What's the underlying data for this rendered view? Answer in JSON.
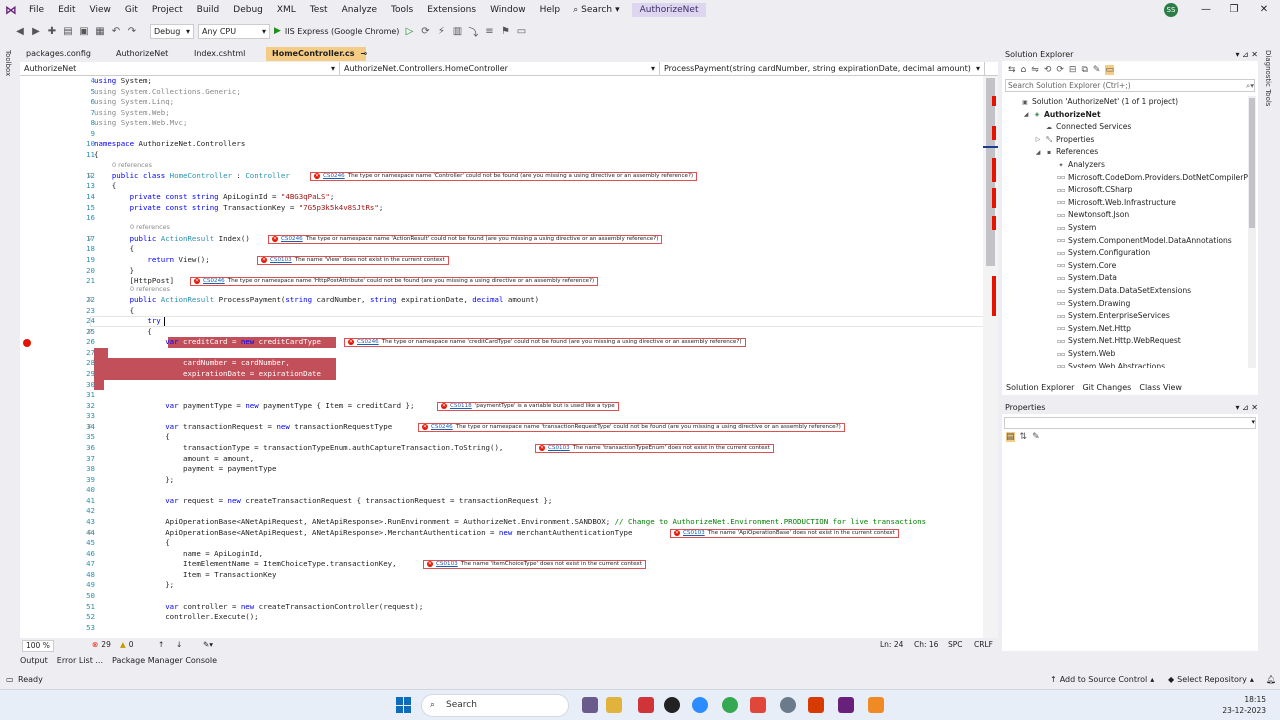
{
  "menubar": {
    "items": [
      "File",
      "Edit",
      "View",
      "Git",
      "Project",
      "Build",
      "Debug",
      "XML",
      "Test",
      "Analyze",
      "Tools",
      "Extensions",
      "Window",
      "Help"
    ],
    "search_label": "Search",
    "solution_title": "AuthorizeNet",
    "user_initials": "SS"
  },
  "toolbar": {
    "config": "Debug",
    "platform": "Any CPU",
    "run_label": "IIS Express (Google Chrome)"
  },
  "sidebars": {
    "left_label": "Toolbox",
    "right_label": "Diagnostic Tools"
  },
  "tabs": [
    {
      "label": "packages.config"
    },
    {
      "label": "AuthorizeNet"
    },
    {
      "label": "Index.cshtml"
    },
    {
      "label": "HomeController.cs",
      "active": true
    }
  ],
  "nav": {
    "project": "AuthorizeNet",
    "class": "AuthorizeNet.Controllers.HomeController",
    "member": "ProcessPayment(string cardNumber, string expirationDate, decimal amount)"
  },
  "code_lines": [
    {
      "n": "4",
      "t": "using System;"
    },
    {
      "n": "5",
      "t": "using System.Collections.Generic;",
      "gray": true
    },
    {
      "n": "6",
      "t": "using System.Linq;",
      "gray": true
    },
    {
      "n": "7",
      "t": "using System.Web;",
      "gray": true
    },
    {
      "n": "8",
      "t": "using System.Web.Mvc;",
      "gray": true
    },
    {
      "n": "9",
      "t": ""
    },
    {
      "n": "10",
      "t": "namespace AuthorizeNet.Controllers"
    },
    {
      "n": "11",
      "t": "{"
    },
    {
      "n": "12",
      "t": "    public class HomeController : Controller"
    },
    {
      "n": "13",
      "t": "    {"
    },
    {
      "n": "14",
      "t": "        private const string ApiLoginId = \"4BG3qPaLS\";"
    },
    {
      "n": "15",
      "t": "        private const string TransactionKey = \"7G5p3k5k4v8SJtRs\";"
    },
    {
      "n": "16",
      "t": ""
    },
    {
      "n": "17",
      "t": "        public ActionResult Index()"
    },
    {
      "n": "18",
      "t": "        {"
    },
    {
      "n": "19",
      "t": "            return View();"
    },
    {
      "n": "20",
      "t": "        }"
    },
    {
      "n": "21",
      "t": "        [HttpPost]"
    },
    {
      "n": "22",
      "t": "        public ActionResult ProcessPayment(string cardNumber, string expirationDate, decimal amount)"
    },
    {
      "n": "23",
      "t": "        {"
    },
    {
      "n": "24",
      "t": "            try"
    },
    {
      "n": "25",
      "t": "            {"
    },
    {
      "n": "26",
      "t": "                var creditCard = new creditCardType"
    },
    {
      "n": "27",
      "t": "                {"
    },
    {
      "n": "28",
      "t": "                    cardNumber = cardNumber,"
    },
    {
      "n": "29",
      "t": "                    expirationDate = expirationDate"
    },
    {
      "n": "30",
      "t": "                };"
    },
    {
      "n": "31",
      "t": ""
    },
    {
      "n": "32",
      "t": "                var paymentType = new paymentType { Item = creditCard };"
    },
    {
      "n": "33",
      "t": ""
    },
    {
      "n": "34",
      "t": "                var transactionRequest = new transactionRequestType"
    },
    {
      "n": "35",
      "t": "                {"
    },
    {
      "n": "36",
      "t": "                    transactionType = transactionTypeEnum.authCaptureTransaction.ToString(),"
    },
    {
      "n": "37",
      "t": "                    amount = amount,"
    },
    {
      "n": "38",
      "t": "                    payment = paymentType"
    },
    {
      "n": "39",
      "t": "                };"
    },
    {
      "n": "40",
      "t": ""
    },
    {
      "n": "41",
      "t": "                var request = new createTransactionRequest { transactionRequest = transactionRequest };"
    },
    {
      "n": "42",
      "t": ""
    },
    {
      "n": "43",
      "t": "                ApiOperationBase<ANetApiRequest, ANetApiResponse>.RunEnvironment = AuthorizeNet.Environment.SANDBOX; // Change to AuthorizeNet.Environment.PRODUCTION for live transactions"
    },
    {
      "n": "44",
      "t": "                ApiOperationBase<ANetApiRequest, ANetApiResponse>.MerchantAuthentication = new merchantAuthenticationType"
    },
    {
      "n": "45",
      "t": "                {"
    },
    {
      "n": "46",
      "t": "                    name = ApiLoginId,"
    },
    {
      "n": "47",
      "t": "                    ItemElementName = ItemChoiceType.transactionKey,"
    },
    {
      "n": "48",
      "t": "                    Item = TransactionKey"
    },
    {
      "n": "49",
      "t": "                };"
    },
    {
      "n": "50",
      "t": ""
    },
    {
      "n": "51",
      "t": "                var controller = new createTransactionController(request);"
    },
    {
      "n": "52",
      "t": "                controller.Execute();"
    },
    {
      "n": "53",
      "t": ""
    }
  ],
  "references": "0 references",
  "errors": [
    {
      "code": "CS0246",
      "msg": "The type or namespace name 'Controller' could not be found (are you missing a using directive or an assembly reference?)"
    },
    {
      "code": "CS0246",
      "msg": "The type or namespace name 'ActionResult' could not be found (are you missing a using directive or an assembly reference?)"
    },
    {
      "code": "CS0103",
      "msg": "The name 'View' does not exist in the current context"
    },
    {
      "code": "CS0246",
      "msg": "The type or namespace name 'HttpPostAttribute' could not be found (are you missing a using directive or an assembly reference?)"
    },
    {
      "code": "CS0246",
      "msg": "The type or namespace name 'creditCardType' could not be found (are you missing a using directive or an assembly reference?)"
    },
    {
      "code": "CS0118",
      "msg": "'paymentType' is a variable but is used like a type"
    },
    {
      "code": "CS0246",
      "msg": "The type or namespace name 'transactionRequestType' could not be found (are you missing a using directive or an assembly reference?)"
    },
    {
      "code": "CS0103",
      "msg": "The name 'transactionTypeEnum' does not exist in the current context"
    },
    {
      "code": "CS0103",
      "msg": "The name 'ApiOperationBase' does not exist in the current context"
    },
    {
      "code": "CS0103",
      "msg": "The name 'ItemChoiceType' does not exist in the current context"
    }
  ],
  "status": {
    "zoom": "100 %",
    "errors": "29",
    "warnings": "0",
    "position": "Ln: 24",
    "column": "Ch: 16",
    "spc": "SPC",
    "crlf": "CRLF"
  },
  "bottom_tabs": [
    "Output",
    "Error List ...",
    "Package Manager Console"
  ],
  "solution_explorer": {
    "title": "Solution Explorer",
    "search_placeholder": "Search Solution Explorer (Ctrl+;)",
    "items": [
      {
        "label": "Solution 'AuthorizeNet' (1 of 1 project)",
        "indent": 0
      },
      {
        "label": "AuthorizeNet",
        "indent": 1,
        "bold": true
      },
      {
        "label": "Connected Services",
        "indent": 2
      },
      {
        "label": "Properties",
        "indent": 2
      },
      {
        "label": "References",
        "indent": 2
      },
      {
        "label": "Analyzers",
        "indent": 3
      },
      {
        "label": "Microsoft.CodeDom.Providers.DotNetCompilerPlatfo",
        "indent": 3
      },
      {
        "label": "Microsoft.CSharp",
        "indent": 3
      },
      {
        "label": "Microsoft.Web.Infrastructure",
        "indent": 3
      },
      {
        "label": "Newtonsoft.Json",
        "indent": 3
      },
      {
        "label": "System",
        "indent": 3
      },
      {
        "label": "System.ComponentModel.DataAnnotations",
        "indent": 3
      },
      {
        "label": "System.Configuration",
        "indent": 3
      },
      {
        "label": "System.Core",
        "indent": 3
      },
      {
        "label": "System.Data",
        "indent": 3
      },
      {
        "label": "System.Data.DataSetExtensions",
        "indent": 3
      },
      {
        "label": "System.Drawing",
        "indent": 3
      },
      {
        "label": "System.EnterpriseServices",
        "indent": 3
      },
      {
        "label": "System.Net.Http",
        "indent": 3
      },
      {
        "label": "System.Net.Http.WebRequest",
        "indent": 3
      },
      {
        "label": "System.Web",
        "indent": 3
      },
      {
        "label": "System.Web.Abstractions",
        "indent": 3
      }
    ],
    "tabs": [
      "Solution Explorer",
      "Git Changes",
      "Class View"
    ]
  },
  "properties": {
    "title": "Properties"
  },
  "statusline": {
    "ready": "Ready",
    "source_control": "Add to Source Control",
    "repo": "Select Repository"
  },
  "taskbar": {
    "search": "Search",
    "time": "18:15",
    "date": "23-12-2023"
  }
}
